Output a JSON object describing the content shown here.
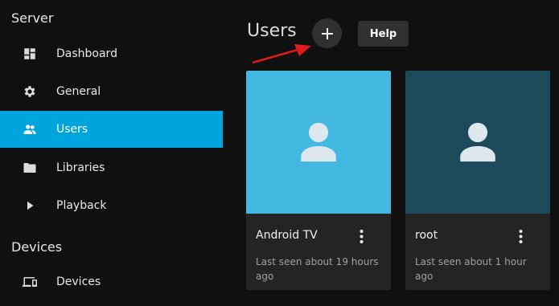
{
  "sidebar": {
    "sections": [
      {
        "title": "Server"
      },
      {
        "title": "Devices"
      }
    ],
    "items": [
      {
        "label": "Dashboard",
        "icon": "dashboard-icon"
      },
      {
        "label": "General",
        "icon": "gear-icon"
      },
      {
        "label": "Users",
        "icon": "people-icon",
        "active": true
      },
      {
        "label": "Libraries",
        "icon": "folder-icon"
      },
      {
        "label": "Playback",
        "icon": "play-icon"
      },
      {
        "label": "Devices",
        "icon": "devices-icon"
      }
    ]
  },
  "main": {
    "title": "Users",
    "add_button_icon": "plus-icon",
    "help_label": "Help",
    "users": [
      {
        "name": "Android TV",
        "last_seen": "Last seen about 19 hours ago",
        "avatar_bg": "#43b9e2"
      },
      {
        "name": "root",
        "last_seen": "Last seen about 1 hour ago",
        "avatar_bg": "#1d4a5b"
      }
    ]
  },
  "colors": {
    "accent": "#00a4dc",
    "background": "#101010",
    "card": "#242424",
    "annotation_arrow": "#e01b1b"
  }
}
